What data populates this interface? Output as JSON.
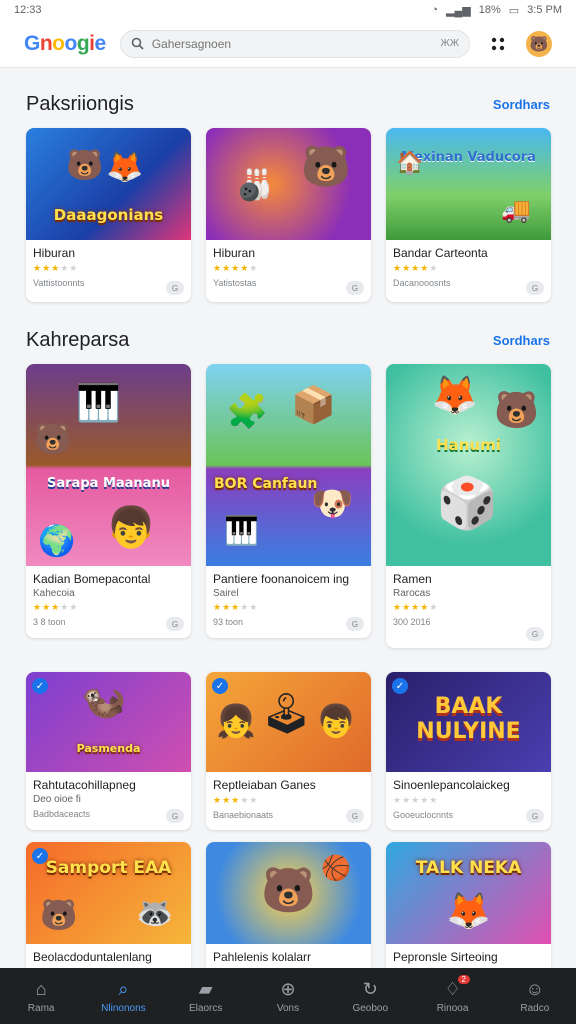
{
  "status": {
    "time": "12:33",
    "battery": "18%",
    "right_time": "3:5 PM"
  },
  "header": {
    "logo": "Gnoogie",
    "search_placeholder": "Gahersagnoen",
    "search_clear": "ЖЖ"
  },
  "sections": [
    {
      "title": "Paksriiongis",
      "see_all": "Sordhars",
      "cards": [
        {
          "title": "Hiburan",
          "banner": "Daaagonians",
          "rating": 3,
          "meta": "Vattistoonnts"
        },
        {
          "title": "Hiburan",
          "banner": "",
          "rating": 4,
          "meta": "Yatistostas"
        },
        {
          "title": "Bandar Carteonta",
          "banner": "Mexinan Vaducora",
          "rating": 4,
          "meta": "Dacanooosnts"
        }
      ]
    },
    {
      "title": "Kahreparsa",
      "see_all": "Sordhars",
      "cards": [
        {
          "title": "Kadian Bomepacontal",
          "sub": "Kahecoia",
          "banner": "Sarapa Maananu",
          "rating": 3,
          "meta": "3 8 toon"
        },
        {
          "title": "Pantiere foonanoicem ing",
          "sub": "Sairel",
          "banner": "BOR Canfaun",
          "rating": 3,
          "meta": "93 toon"
        },
        {
          "title": "Ramen",
          "sub": "Rarocas",
          "banner": "Hanumi",
          "rating": 4,
          "meta": "300 2016"
        },
        {
          "title": "Rahtutacohillapneg",
          "sub": "Deo oioe fi",
          "banner": "Pasmenda",
          "rating": 0,
          "meta": "Badbdaceacts"
        },
        {
          "title": "Reptleiaban Ganes",
          "sub": "",
          "banner": "",
          "rating": 3,
          "meta": "Banaebionaats"
        },
        {
          "title": "Sinoenlepancolaickeg",
          "sub": "",
          "banner": "BAAK NULYINE",
          "rating": 0,
          "meta": "Gooeuclocnnts"
        },
        {
          "title": "Beolacdoduntalenlang",
          "sub": "",
          "banner": "Samport EAA",
          "rating": 3,
          "meta": ""
        },
        {
          "title": "Pahlelenis kolalarr",
          "sub": "",
          "banner": "",
          "rating": 3,
          "meta": ""
        },
        {
          "title": "Pepronsle Sirteoing",
          "sub": "",
          "banner": "TALK NEKA",
          "rating": 3,
          "meta": ""
        }
      ]
    }
  ],
  "nav": [
    {
      "label": "Rama",
      "icon": "home-icon",
      "glyph": "⌂"
    },
    {
      "label": "Nlinonons",
      "icon": "search-icon",
      "glyph": "⌕"
    },
    {
      "label": "Elaorcs",
      "icon": "folder-icon",
      "glyph": "▰"
    },
    {
      "label": "Vons",
      "icon": "compass-icon",
      "glyph": "⊕"
    },
    {
      "label": "Geoboo",
      "icon": "refresh-icon",
      "glyph": "↻"
    },
    {
      "label": "Rinooa",
      "icon": "notifications-icon",
      "glyph": "♢",
      "badge": "2"
    },
    {
      "label": "Radco",
      "icon": "profile-icon",
      "glyph": "☺"
    }
  ],
  "colors": {
    "accent": "#1a73e8",
    "nav_bg": "#1f2022",
    "star": "#f4b400"
  }
}
